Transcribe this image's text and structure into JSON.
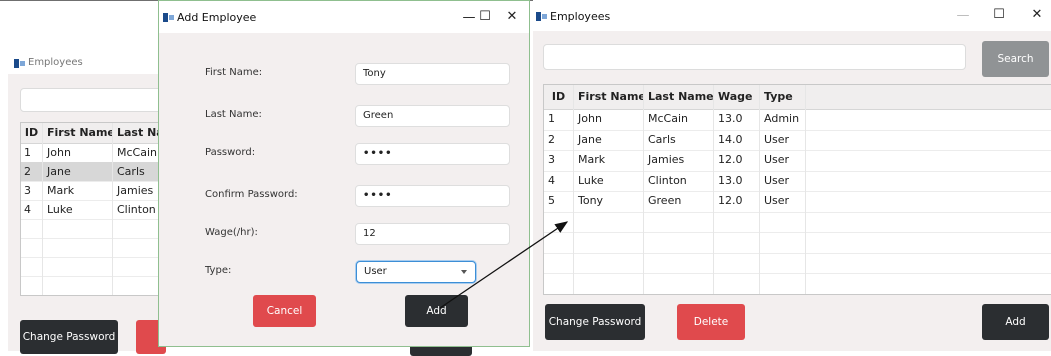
{
  "left_window": {
    "title": "Employees",
    "columns": [
      "ID",
      "First Name",
      "Last Nam"
    ],
    "rows": [
      [
        "1",
        "John",
        "McCain"
      ],
      [
        "2",
        "Jane",
        "Carls"
      ],
      [
        "3",
        "Mark",
        "Jamies"
      ],
      [
        "4",
        "Luke",
        "Clinton"
      ]
    ],
    "selected_row": 1,
    "change_password_label": "Change Password"
  },
  "dialog": {
    "title": "Add Employee",
    "minimize": "—",
    "maximize": "☐",
    "close": "✕",
    "fields": [
      {
        "label": "First Name:",
        "value": "Tony"
      },
      {
        "label": "Last Name:",
        "value": "Green"
      },
      {
        "label": "Password:",
        "value": "••••"
      },
      {
        "label": "Confirm Password:",
        "value": "••••"
      },
      {
        "label": "Wage(/hr):",
        "value": "12"
      }
    ],
    "type_label": "Type:",
    "type_value": "User",
    "cancel_label": "Cancel",
    "add_label": "Add"
  },
  "right_window": {
    "title": "Employees",
    "minimize": "—",
    "maximize": "☐",
    "close": "✕",
    "search_value": "",
    "search_label": "Search",
    "columns": [
      "ID",
      "First Name",
      "Last Name",
      "Wage",
      "Type"
    ],
    "rows": [
      [
        "1",
        "John",
        "McCain",
        "13.0",
        "Admin"
      ],
      [
        "2",
        "Jane",
        "Carls",
        "14.0",
        "User"
      ],
      [
        "3",
        "Mark",
        "Jamies",
        "12.0",
        "User"
      ],
      [
        "4",
        "Luke",
        "Clinton",
        "13.0",
        "User"
      ],
      [
        "5",
        "Tony",
        "Green",
        "12.0",
        "User"
      ]
    ],
    "change_password_label": "Change Password",
    "delete_label": "Delete",
    "add_label": "Add"
  },
  "colors": {
    "window_bg": "#f3efef",
    "dark_button": "#2b2e31",
    "red_button": "#e04a4d",
    "gray_button": "#909395",
    "focus_blue": "#3c8ed6"
  }
}
